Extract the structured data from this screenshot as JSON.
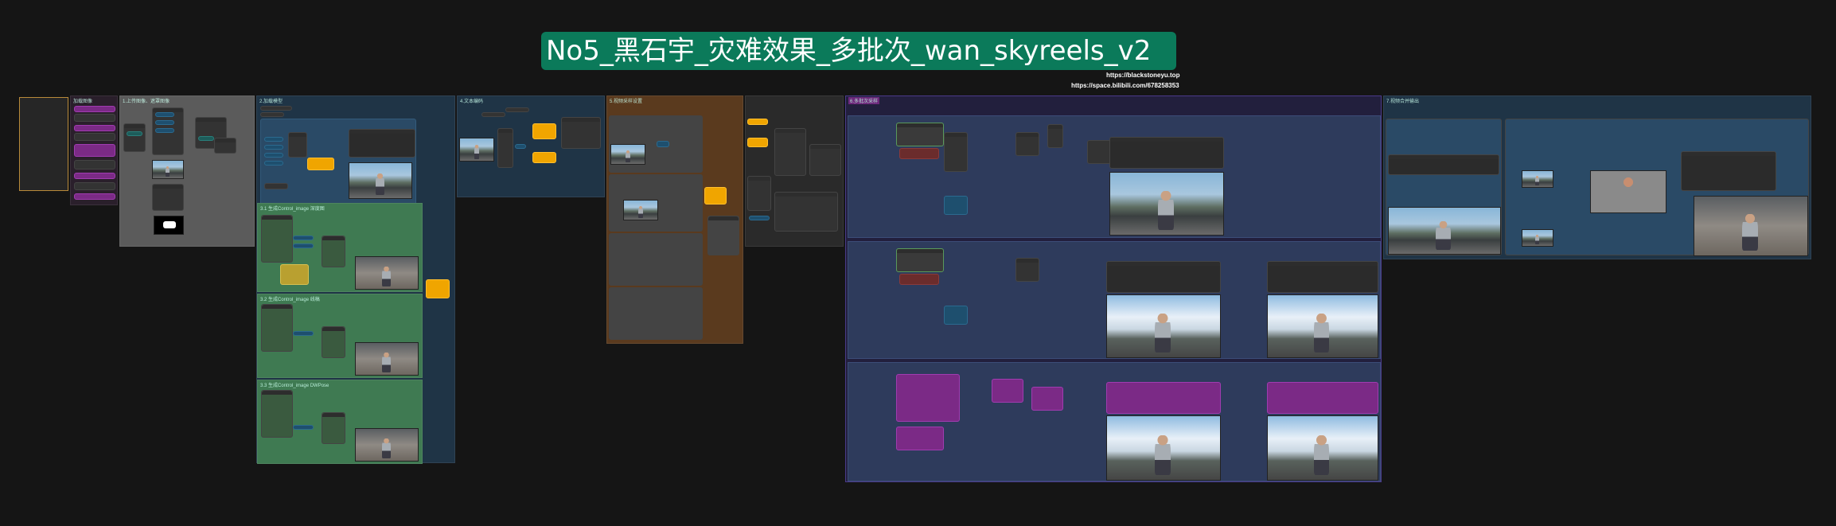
{
  "title": "No5_黑石宇_灾难效果_多批次_wan_skyreels_v2",
  "links": {
    "site": "https://blackstoneyu.top",
    "bilibili": "https://space.bilibili.com/678258353"
  },
  "colors": {
    "canvas": "#151515",
    "title_bg": "#0b7a5a",
    "group_blue": "#233f56",
    "group_green": "#3f7a52",
    "group_orange": "#5a3a1e",
    "group_purple": "#2b2a52",
    "group_gray": "#5b5b5b",
    "widget_orange": "#f0a500",
    "widget_purple": "#7b2a86"
  },
  "groups": [
    {
      "id": "g1",
      "title": "",
      "color": "#2a2a2a"
    },
    {
      "id": "g2",
      "title": "加载图像",
      "color": "#3a2a3a"
    },
    {
      "id": "g3",
      "title": "1.上传图像、遮罩图像",
      "color": "#5b5b5b"
    },
    {
      "id": "g4",
      "title": "2.加载模型",
      "color": "#233f56"
    },
    {
      "id": "g5",
      "title": "3.1 生成Control_image 深度图",
      "color": "#3f7a52"
    },
    {
      "id": "g6",
      "title": "3.2 生成Control_image 线稿",
      "color": "#3f7a52"
    },
    {
      "id": "g7",
      "title": "3.3 生成Control_image DWPose",
      "color": "#3f7a52"
    },
    {
      "id": "g8",
      "title": "4.文本编码",
      "color": "#233f56"
    },
    {
      "id": "g9",
      "title": "5.视频采样设置",
      "color": "#5a3a1e"
    },
    {
      "id": "g10",
      "title": "",
      "color": "#2a2a2a"
    },
    {
      "id": "g11",
      "title": "6.多批次采样",
      "color": "#2b2a52"
    },
    {
      "id": "g12",
      "title": "7.视频合并输出",
      "color": "#233f56"
    }
  ]
}
